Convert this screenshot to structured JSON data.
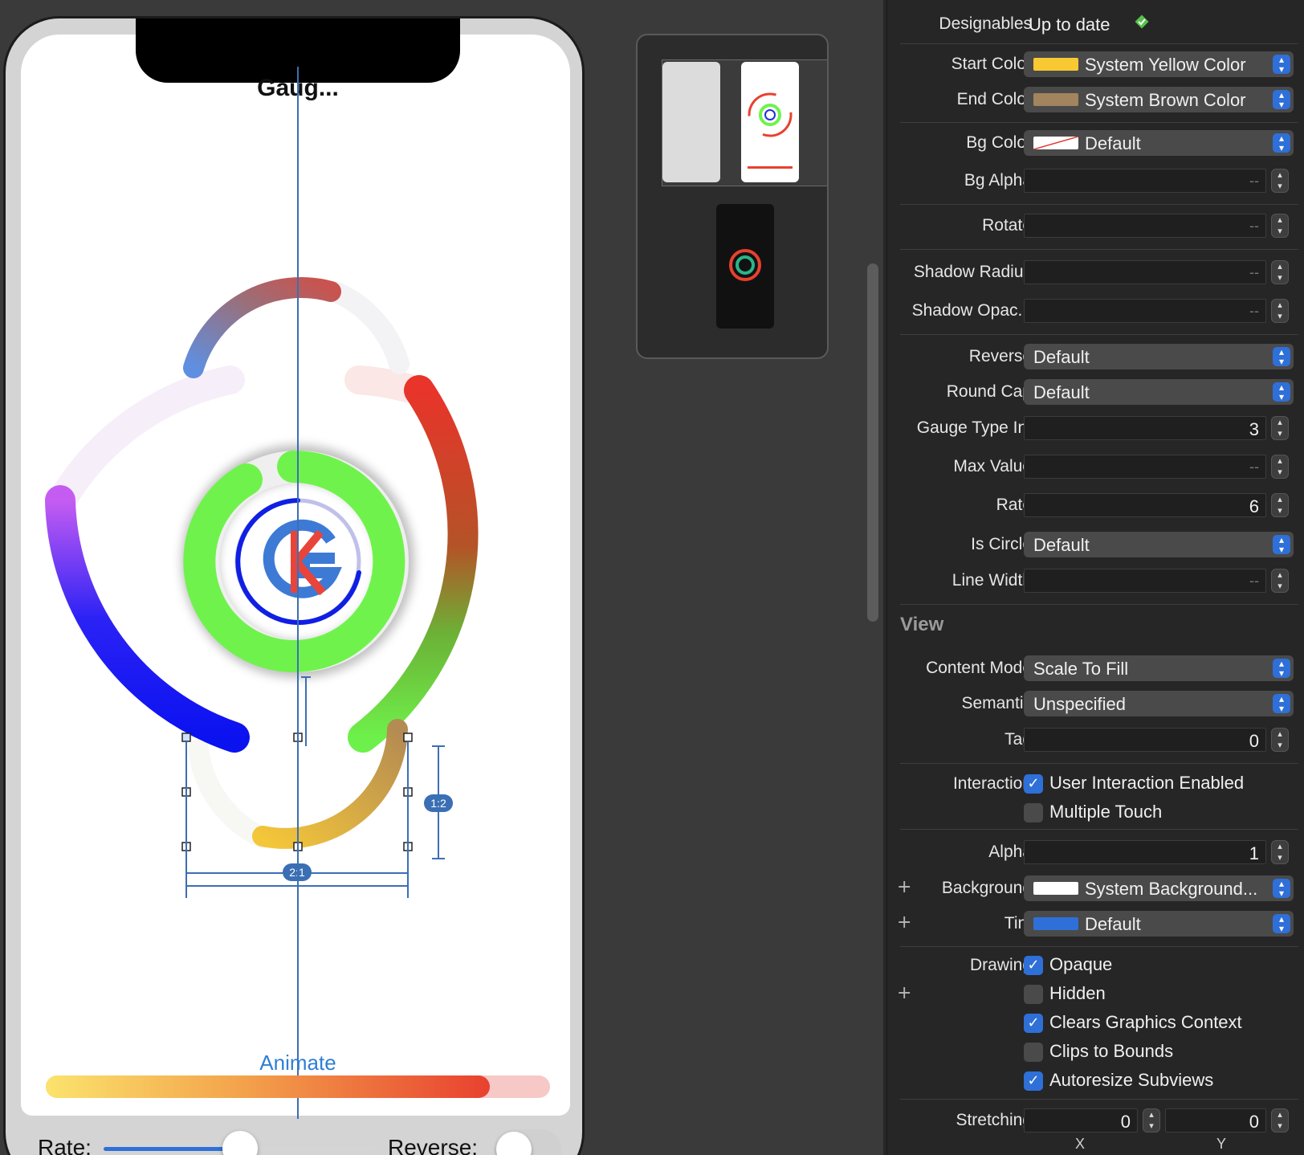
{
  "canvas": {
    "nav_title": "Gaug...",
    "animate_label": "Animate",
    "progress_fraction": 0.88,
    "rate_label": "Rate:",
    "rate_slider_fraction": 0.5,
    "reverse_label": "Reverse:",
    "reverse_on": false,
    "constraint_height_ratio": "1:2",
    "constraint_width_ratio": "2:1"
  },
  "inspector": {
    "designables": {
      "label": "Designables",
      "value": "Up to date",
      "status_icon": "checkmark-diamond-icon",
      "status_color": "#57c24b"
    },
    "start_color": {
      "label": "Start Color",
      "value": "System Yellow Color",
      "swatch": "#f8c933"
    },
    "end_color": {
      "label": "End Color",
      "value": "System Brown Color",
      "swatch": "#a2845e"
    },
    "bg_color": {
      "label": "Bg Color",
      "value": "Default"
    },
    "bg_alpha": {
      "label": "Bg Alpha",
      "value": "--"
    },
    "rotate": {
      "label": "Rotate",
      "value": "--"
    },
    "shadow_radius": {
      "label": "Shadow Radius",
      "value": "--"
    },
    "shadow_opacity": {
      "label": "Shadow Opac...",
      "value": "--"
    },
    "reverse": {
      "label": "Reverse",
      "value": "Default"
    },
    "round_cap": {
      "label": "Round Cap",
      "value": "Default"
    },
    "gauge_type_int": {
      "label": "Gauge Type Int",
      "value": "3"
    },
    "max_value": {
      "label": "Max Value",
      "value": "--"
    },
    "rate": {
      "label": "Rate",
      "value": "6"
    },
    "is_circle": {
      "label": "Is Circle",
      "value": "Default"
    },
    "line_width": {
      "label": "Line Width",
      "value": "--"
    },
    "view_section": "View",
    "content_mode": {
      "label": "Content Mode",
      "value": "Scale To Fill"
    },
    "semantic": {
      "label": "Semantic",
      "value": "Unspecified"
    },
    "tag": {
      "label": "Tag",
      "value": "0"
    },
    "interaction": {
      "label": "Interaction",
      "user_interaction_enabled": {
        "label": "User Interaction Enabled",
        "checked": true
      },
      "multiple_touch": {
        "label": "Multiple Touch",
        "checked": false
      }
    },
    "alpha": {
      "label": "Alpha",
      "value": "1"
    },
    "background": {
      "label": "Background",
      "value": "System Background...",
      "swatch": "#ffffff"
    },
    "tint": {
      "label": "Tint",
      "value": "Default",
      "swatch": "#2f6fd8"
    },
    "drawing": {
      "label": "Drawing",
      "opaque": {
        "label": "Opaque",
        "checked": true
      },
      "hidden": {
        "label": "Hidden",
        "checked": false
      },
      "clears_graphics_context": {
        "label": "Clears Graphics Context",
        "checked": true
      },
      "clips_to_bounds": {
        "label": "Clips to Bounds",
        "checked": false
      },
      "autoresize_subviews": {
        "label": "Autoresize Subviews",
        "checked": true
      }
    },
    "stretching": {
      "label": "Stretching",
      "x_value": "0",
      "y_value": "0",
      "x_caption": "X",
      "y_caption": "Y"
    }
  }
}
